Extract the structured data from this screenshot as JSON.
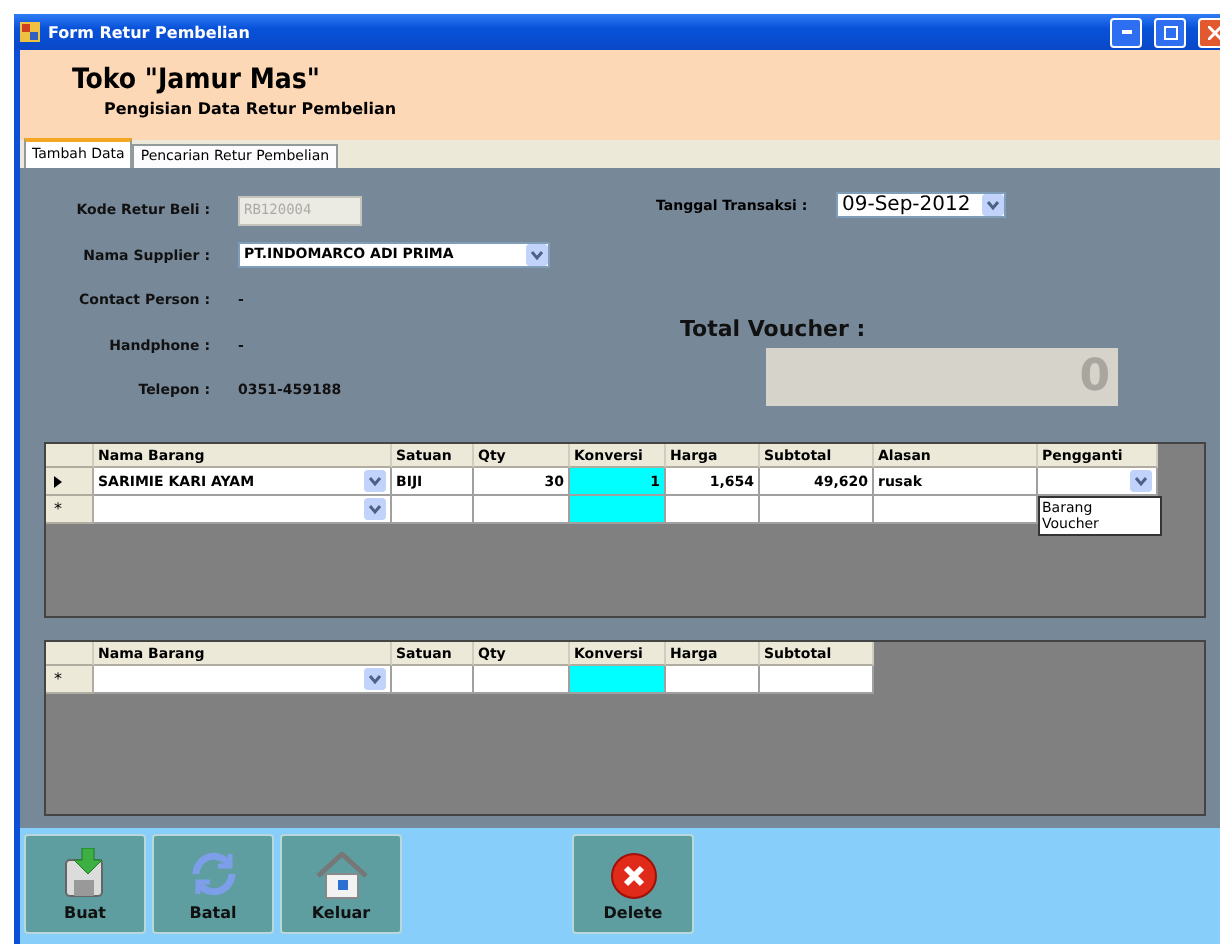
{
  "window": {
    "title": "Form Retur Pembelian"
  },
  "header": {
    "title": "Toko \"Jamur Mas\"",
    "subtitle": "Pengisian Data Retur Pembelian"
  },
  "tabs": [
    {
      "label": "Tambah Data",
      "selected": true
    },
    {
      "label": "Pencarian Retur Pembelian",
      "selected": false
    }
  ],
  "form": {
    "fields": [
      {
        "label": "Kode Retur Beli :",
        "kind": "input",
        "value": "RB120004",
        "disabled": true
      },
      {
        "label": "Nama Supplier :",
        "kind": "combo",
        "value": "PT.INDOMARCO ADI PRIMA"
      },
      {
        "label": "Contact Person :",
        "kind": "text",
        "value": "-"
      },
      {
        "label": "Handphone :",
        "kind": "text",
        "value": "-"
      },
      {
        "label": "Telepon :",
        "kind": "text",
        "value": "0351-459188"
      }
    ],
    "date": {
      "label": "Tanggal Transaksi :",
      "value": "09-Sep-2012"
    },
    "total": {
      "label": "Total Voucher :",
      "value": "0"
    }
  },
  "grids": [
    {
      "columns": [
        {
          "label": "Nama Barang",
          "kind": "combo"
        },
        {
          "label": "Satuan",
          "kind": "text"
        },
        {
          "label": "Qty",
          "kind": "number"
        },
        {
          "label": "Konversi",
          "kind": "highlight"
        },
        {
          "label": "Harga",
          "kind": "number"
        },
        {
          "label": "Subtotal",
          "kind": "number"
        },
        {
          "label": "Alasan",
          "kind": "text"
        },
        {
          "label": "Pengganti",
          "kind": "combo",
          "options": [
            "Barang",
            "Voucher"
          ]
        }
      ],
      "rows": [
        {
          "kind": "current",
          "cells": [
            "SARIMIE KARI AYAM",
            "BIJI",
            "30",
            "1",
            "1,654",
            "49,620",
            "rusak",
            ""
          ]
        },
        {
          "kind": "new",
          "marker": "*",
          "cells": [
            "",
            "",
            "",
            "",
            "",
            "",
            ""
          ]
        }
      ]
    },
    {
      "columns": [
        {
          "label": "Nama Barang",
          "kind": "combo"
        },
        {
          "label": "Satuan",
          "kind": "text"
        },
        {
          "label": "Qty",
          "kind": "number"
        },
        {
          "label": "Konversi",
          "kind": "highlight"
        },
        {
          "label": "Harga",
          "kind": "number"
        },
        {
          "label": "Subtotal",
          "kind": "number"
        }
      ],
      "rows": [
        {
          "kind": "new",
          "marker": "*",
          "cells": [
            "",
            "",
            "",
            "",
            "",
            ""
          ]
        }
      ]
    }
  ],
  "buttons": [
    {
      "label": "Buat",
      "kind": "save"
    },
    {
      "label": "Batal",
      "kind": "refresh"
    },
    {
      "label": "Keluar",
      "kind": "home"
    },
    {
      "label": "Delete",
      "kind": "delete"
    }
  ]
}
